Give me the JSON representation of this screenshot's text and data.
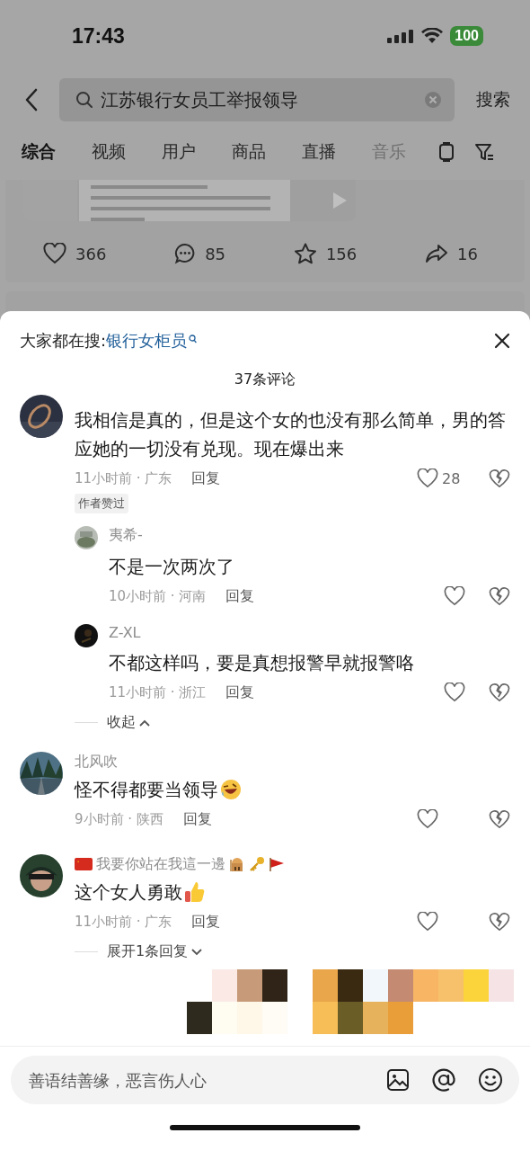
{
  "status_bar": {
    "time": "17:43",
    "battery": "100"
  },
  "search": {
    "value": "江苏银行女员工举报领导",
    "button": "搜索"
  },
  "tabs": [
    {
      "label": "综合",
      "selected": true
    },
    {
      "label": "视频",
      "selected": false
    },
    {
      "label": "用户",
      "selected": false
    },
    {
      "label": "商品",
      "selected": false
    },
    {
      "label": "直播",
      "selected": false
    },
    {
      "label": "音乐",
      "selected": false
    }
  ],
  "post": {
    "actions": [
      {
        "kind": "like",
        "count": "366"
      },
      {
        "kind": "comment",
        "count": "85"
      },
      {
        "kind": "favorite",
        "count": "156"
      },
      {
        "kind": "share",
        "count": "16"
      }
    ]
  },
  "comments_sheet": {
    "trending_label": "大家都在搜:",
    "trending_link": "银行女柜员",
    "count": "37条评论",
    "comments": [
      {
        "text": "我相信是真的，但是这个女的也没有那么简单，男的答应她的一切没有兑现。现在爆出来",
        "time": "11小时前 · 广东",
        "reply": "回复",
        "likes": "28",
        "author_liked": true,
        "author_liked_label": "作者赞过",
        "replies": [
          {
            "name": "夷希-",
            "text": "不是一次两次了",
            "time": "10小时前 · 河南",
            "reply": "回复"
          },
          {
            "name": "Z-XL",
            "text": "不都这样吗，要是真想报警早就报警咯",
            "time": "11小时前 · 浙江",
            "reply": "回复"
          }
        ],
        "toggle": {
          "label": "收起",
          "expanded": true
        }
      },
      {
        "name": "北风吹",
        "text": "怪不得都要当领导",
        "emoji": {
          "kind": "laugh"
        },
        "time": "9小时前 · 陕西",
        "reply": "回复",
        "author_liked": false
      },
      {
        "name": "我要你站在我這一邊",
        "name_badges": [
          {
            "kind": "flag"
          },
          {
            "kind": "building"
          },
          {
            "kind": "key"
          },
          {
            "kind": "pennant"
          }
        ],
        "text": "这个女人勇敢",
        "emoji": {
          "kind": "thumbs-up"
        },
        "time": "11小时前 · 广东",
        "reply": "回复",
        "author_liked": false,
        "toggle": {
          "label": "展开1条回复",
          "expanded": false
        }
      }
    ],
    "input": {
      "placeholder": "善语结善缘，恶言伤人心"
    }
  },
  "overlay": {
    "kind": "mosaic"
  }
}
